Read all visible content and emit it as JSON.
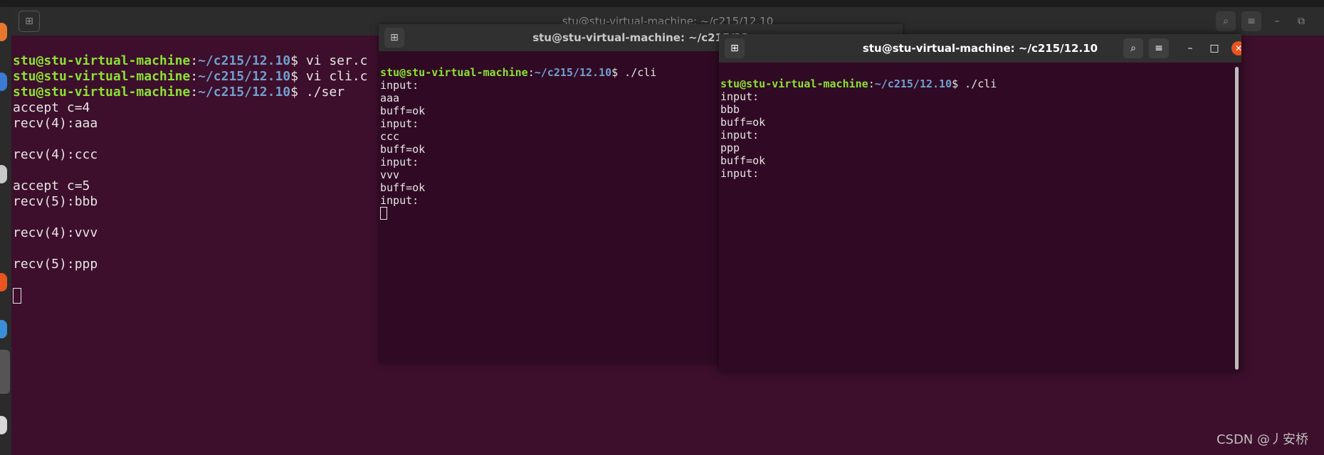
{
  "dock": {
    "icons": [
      "firefox-icon",
      "thunderbird-icon",
      "files-icon",
      "software-icon",
      "help-icon",
      "terminal-icon",
      "disc-icon"
    ]
  },
  "main_window": {
    "title": "stu@stu-virtual-machine: ~/c215/12.10",
    "new_tab_icon": "new-tab-icon",
    "lines": [
      {
        "user": "stu@stu-virtual-machine",
        "path": "~/c215/12.10",
        "cmd": "$ vi ser.c"
      },
      {
        "user": "stu@stu-virtual-machine",
        "path": "~/c215/12.10",
        "cmd": "$ vi cli.c"
      },
      {
        "user": "stu@stu-virtual-machine",
        "path": "~/c215/12.10",
        "cmd": "$ ./ser"
      }
    ],
    "output": [
      "accept c=4",
      "recv(4):aaa",
      "",
      "recv(4):ccc",
      "",
      "accept c=5",
      "recv(5):bbb",
      "",
      "recv(4):vvv",
      "",
      "recv(5):ppp",
      ""
    ]
  },
  "mid_window": {
    "title": "stu@stu-virtual-machine: ~/c215/12",
    "prompt": {
      "user": "stu@stu-virtual-machine",
      "path": "~/c215/12.10",
      "cmd": "$ ./cli"
    },
    "output": [
      "input:",
      "aaa",
      "buff=ok",
      "input:",
      "ccc",
      "buff=ok",
      "input:",
      "vvv",
      "buff=ok",
      "input:"
    ]
  },
  "front_window": {
    "title": "stu@stu-virtual-machine: ~/c215/12.10",
    "prompt": {
      "user": "stu@stu-virtual-machine",
      "path": "~/c215/12.10",
      "cmd": "$ ./cli"
    },
    "output": [
      "input:",
      "bbb",
      "buff=ok",
      "input:",
      "ppp",
      "buff=ok",
      "input:"
    ]
  },
  "watermark": "CSDN @丿安桥",
  "colors": {
    "user": "#8ae234",
    "path": "#729fcf",
    "bg": "#300a24",
    "close": "#e95420"
  }
}
